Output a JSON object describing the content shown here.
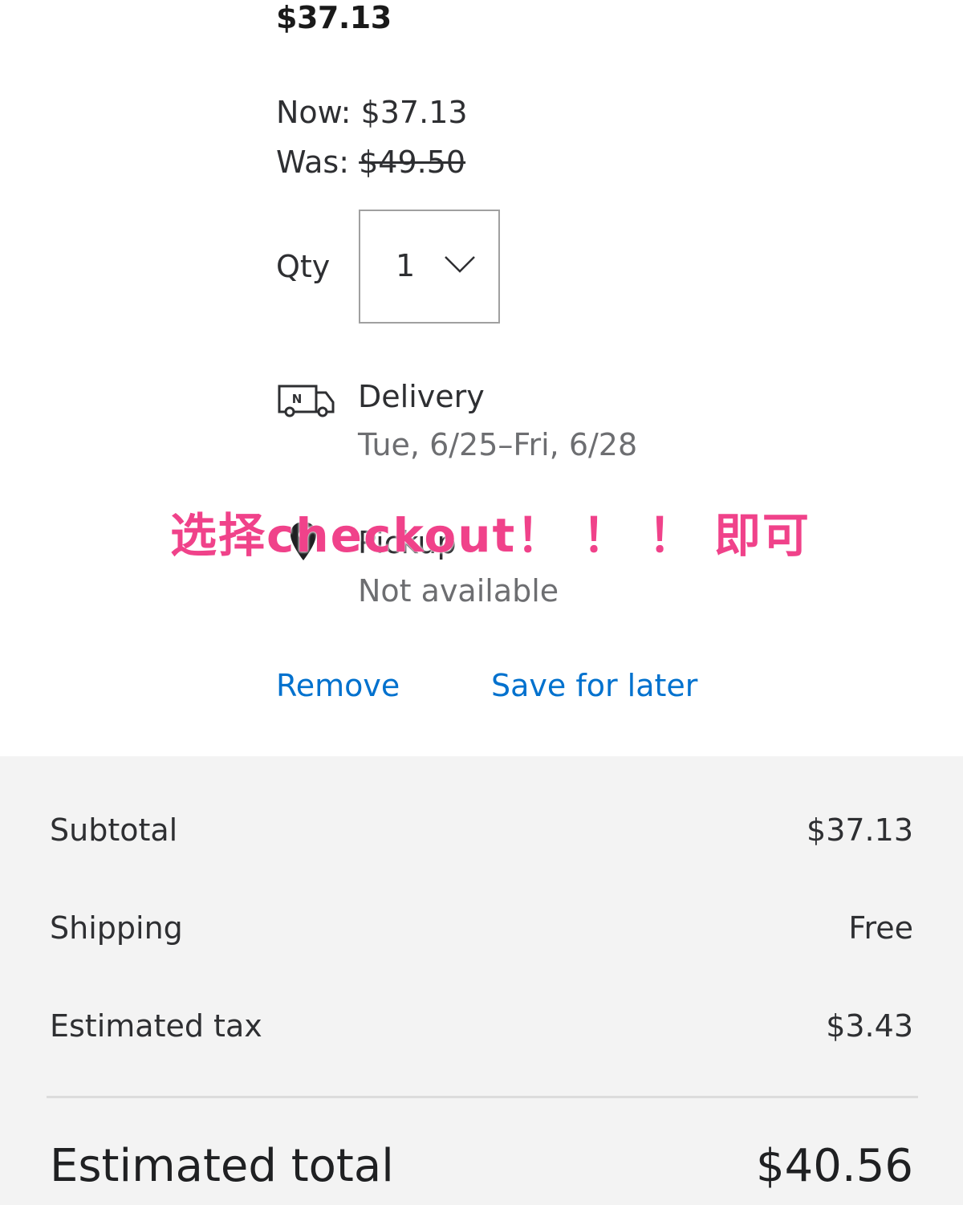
{
  "item": {
    "price": "$37.13",
    "now_label": "Now:",
    "now_price": "$37.13",
    "was_label": "Was:",
    "was_price": "$49.50",
    "qty_label": "Qty",
    "qty_value": "1",
    "delivery": {
      "title": "Delivery",
      "dates": "Tue, 6/25–Fri, 6/28",
      "icon": "delivery-truck-icon"
    },
    "pickup": {
      "title": "Pickup",
      "status": "Not available",
      "icon": "location-pin-icon"
    },
    "remove_label": "Remove",
    "save_for_later_label": "Save for later"
  },
  "overlay_annotation": "选择checkout！ ！ ！ 即可",
  "summary": {
    "rows": [
      {
        "label": "Subtotal",
        "value": "$37.13"
      },
      {
        "label": "Shipping",
        "value": "Free"
      },
      {
        "label": "Estimated tax",
        "value": "$3.43"
      }
    ],
    "total_label": "Estimated total",
    "total_value": "$40.56"
  },
  "colors": {
    "link": "#0071ce",
    "annotation": "#f0428a",
    "summary_background": "#f3f3f3"
  }
}
